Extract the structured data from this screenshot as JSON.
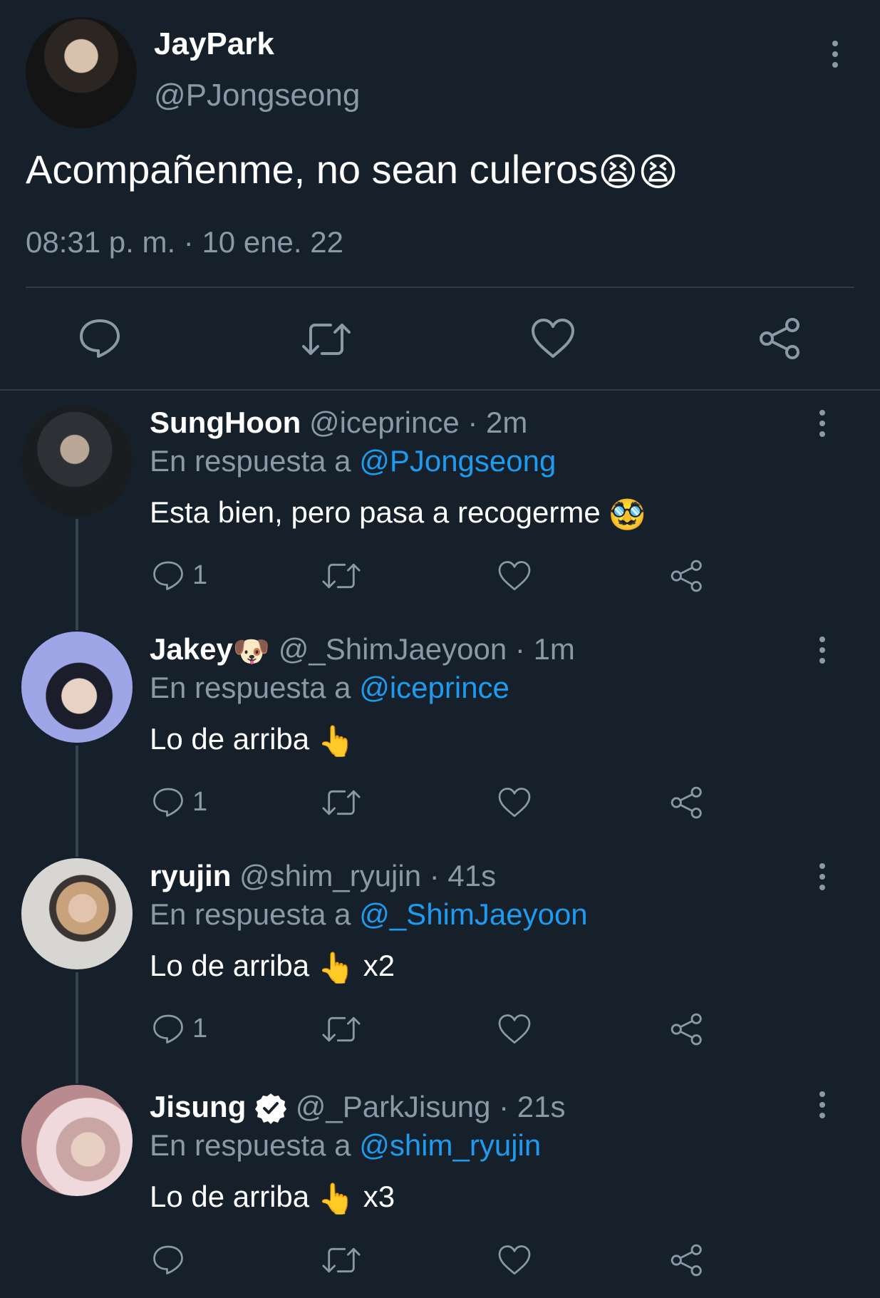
{
  "main_tweet": {
    "author_name": "JayPark",
    "author_handle": "@PJongseong",
    "text": "Acompañenme, no sean culeros",
    "text_emoji": "😫😫",
    "timestamp": "08:31 p. m. · 10 ene. 22"
  },
  "replies": [
    {
      "name": "SungHoon",
      "name_emoji": "",
      "verified": false,
      "handle": "@iceprince",
      "time": "· 2m",
      "reply_prefix": "En respuesta a",
      "reply_to": "@PJongseong",
      "text": "Esta bien, pero pasa a recogerme",
      "text_emoji": "🥸",
      "text_suffix": "",
      "reply_count": "1"
    },
    {
      "name": "Jakey",
      "name_emoji": "🐶",
      "verified": false,
      "handle": "@_ShimJaeyoon",
      "time": "· 1m",
      "reply_prefix": "En respuesta a",
      "reply_to": "@iceprince",
      "text": "Lo de arriba",
      "text_emoji": "👆",
      "text_suffix": "",
      "reply_count": "1"
    },
    {
      "name": "ryujin",
      "name_emoji": "",
      "verified": false,
      "handle": "@shim_ryujin",
      "time": "· 41s",
      "reply_prefix": "En respuesta a",
      "reply_to": "@_ShimJaeyoon",
      "text": "Lo de arriba",
      "text_emoji": "👆",
      "text_suffix": "x2",
      "reply_count": "1"
    },
    {
      "name": "Jisung",
      "name_emoji": "",
      "verified": true,
      "handle": "@_ParkJisung",
      "time": "· 21s",
      "reply_prefix": "En respuesta a",
      "reply_to": "@shim_ryujin",
      "text": "Lo de arriba",
      "text_emoji": "👆",
      "text_suffix": "x3",
      "reply_count": ""
    }
  ],
  "icons": {
    "reply": "reply-icon",
    "retweet": "retweet-icon",
    "like": "heart-icon",
    "share": "share-icon",
    "more": "more-vertical-icon",
    "verified": "verified-badge-icon"
  },
  "colors": {
    "background": "#15202b",
    "text": "#ffffff",
    "muted": "#8b98a5",
    "link": "#1d9bf0",
    "divider": "#2f3a45"
  }
}
